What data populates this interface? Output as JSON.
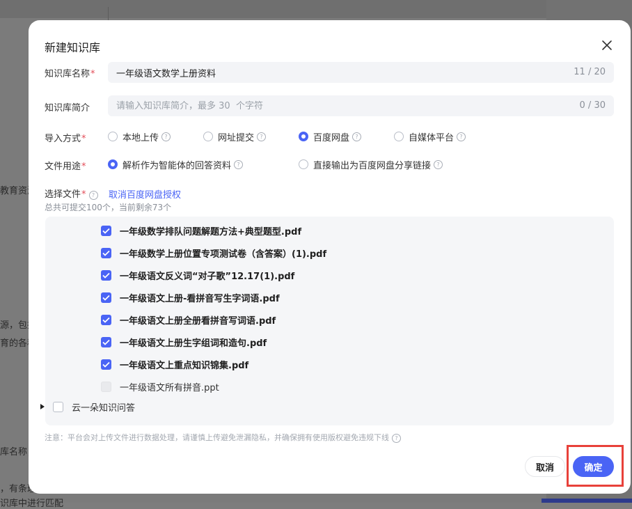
{
  "background": {
    "snippets": [
      "教育资源",
      "源，包括",
      "育的各种",
      "库名称，",
      "，有条理",
      "识库中进行匹配"
    ]
  },
  "dialog": {
    "title": "新建知识库",
    "name_label": "知识库名称",
    "name_value": "一年级语文数学上册资料",
    "name_counter": "11 / 20",
    "intro_label": "知识库简介",
    "intro_placeholder": "请输入知识库简介，最多 30  个字符",
    "intro_counter": "0 / 30",
    "import_label": "导入方式",
    "import_options": [
      {
        "label": "本地上传",
        "selected": false
      },
      {
        "label": "网址提交",
        "selected": false
      },
      {
        "label": "百度网盘",
        "selected": true
      },
      {
        "label": "自媒体平台",
        "selected": false
      }
    ],
    "usage_label": "文件用途",
    "usage_options": [
      {
        "label": "解析作为智能体的回答资料",
        "selected": true
      },
      {
        "label": "直接输出为百度网盘分享链接",
        "selected": false
      }
    ],
    "files_label": "选择文件",
    "revoke_link": "取消百度网盘授权",
    "quota_note": "总共可提交100个，当前剩余73个",
    "files": [
      {
        "name": "一年级数学排队问题解题方法+典型题型.pdf",
        "checked": true
      },
      {
        "name": "一年级数学上册位置专项测试卷（含答案）(1).pdf",
        "checked": true
      },
      {
        "name": "一年级语文反义词“对子歌”12.17(1).pdf",
        "checked": true
      },
      {
        "name": "一年级语文上册-看拼音写生字词语.pdf",
        "checked": true
      },
      {
        "name": "一年级语文上册全册看拼音写词语.pdf",
        "checked": true
      },
      {
        "name": "一年级语文上册生字组词和造句.pdf",
        "checked": true
      },
      {
        "name": "一年级语文上重点知识锦集.pdf",
        "checked": true
      },
      {
        "name": "一年级语文所有拼音.ppt",
        "checked": false
      }
    ],
    "folder": {
      "name": "云一朵知识问答",
      "checked": false
    },
    "footnote": "注意：平台会对上传文件进行数据处理，请谨慎上传避免泄漏隐私，并确保拥有使用版权避免违规下线",
    "cancel_label": "取消",
    "confirm_label": "确定",
    "accent_color": "#4a64f5",
    "highlight_color": "#e8413a"
  }
}
